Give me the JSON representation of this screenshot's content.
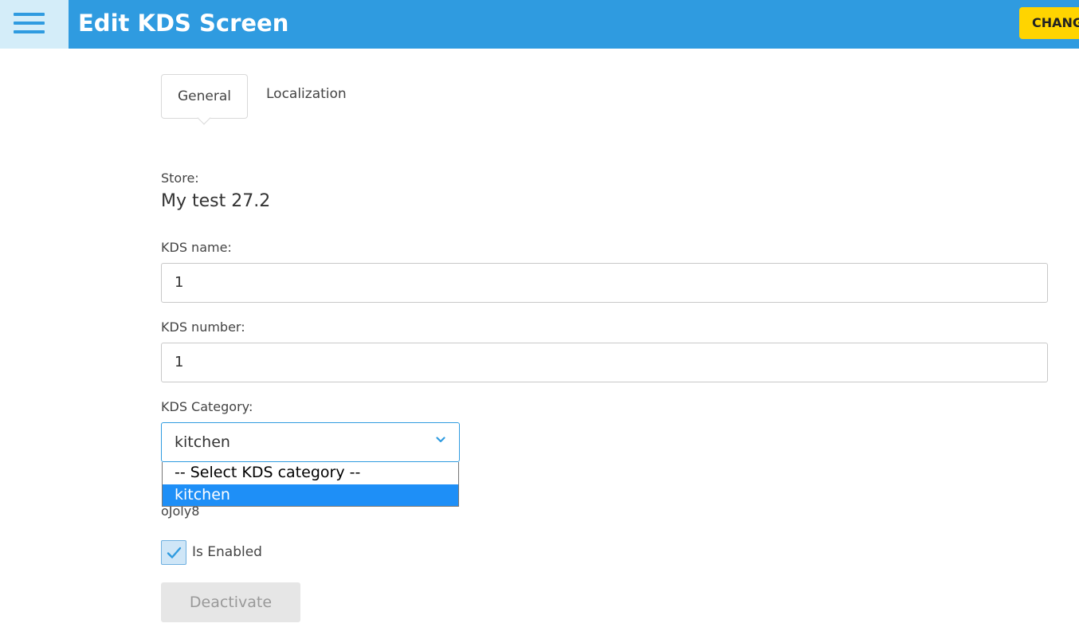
{
  "header": {
    "title": "Edit KDS Screen",
    "change_label": "CHANG",
    "menu_icon": "hamburger-icon"
  },
  "tabs": [
    {
      "label": "General",
      "active": true
    },
    {
      "label": "Localization",
      "active": false
    }
  ],
  "form": {
    "store_label": "Store:",
    "store_value": "My test 27.2",
    "kds_name_label": "KDS name:",
    "kds_name_value": "1",
    "kds_number_label": "KDS number:",
    "kds_number_value": "1",
    "kds_category_label": "KDS Category:",
    "kds_category_value": "kitchen",
    "hidden_text": "oJoly8",
    "category_options": [
      {
        "label": "-- Select KDS category --",
        "selected": false
      },
      {
        "label": "kitchen",
        "selected": true
      }
    ],
    "is_enabled_label": "Is Enabled",
    "is_enabled": true,
    "deactivate_label": "Deactivate"
  },
  "colors": {
    "header_bg": "#2f9be0",
    "menu_bg": "#d4edf9",
    "change_bg": "#ffd400",
    "selected_option_bg": "#1e8ff7"
  }
}
